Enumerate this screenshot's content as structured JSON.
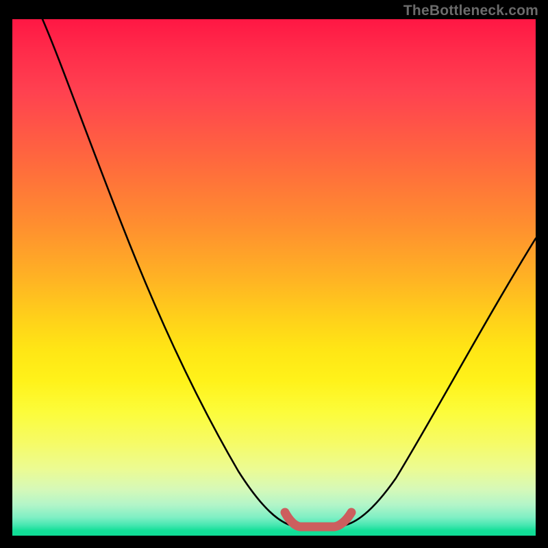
{
  "watermark": "TheBottleneck.com",
  "chart_data": {
    "type": "line",
    "title": "",
    "xlabel": "",
    "ylabel": "",
    "xlim": [
      0,
      100
    ],
    "ylim": [
      0,
      100
    ],
    "series": [
      {
        "name": "bottleneck-curve",
        "x": [
          1,
          5,
          10,
          15,
          20,
          25,
          30,
          35,
          40,
          45,
          50,
          53,
          55,
          58,
          60,
          62,
          63,
          65,
          68,
          72,
          78,
          84,
          90,
          96,
          100
        ],
        "values": [
          100,
          95,
          88,
          80,
          72,
          64,
          55,
          46,
          37,
          27,
          17,
          10,
          5,
          2,
          1,
          1,
          1,
          2,
          5,
          10,
          20,
          32,
          44,
          54,
          60
        ]
      },
      {
        "name": "optimal-zone",
        "x": [
          53,
          55,
          57,
          59,
          61,
          63
        ],
        "values": [
          4,
          2,
          1,
          1,
          2,
          4
        ]
      }
    ],
    "gradient_stops": [
      {
        "pos": 0,
        "color": "#ff1744"
      },
      {
        "pos": 50,
        "color": "#ffb224"
      },
      {
        "pos": 72,
        "color": "#fff21a"
      },
      {
        "pos": 100,
        "color": "#0fdc95"
      }
    ]
  }
}
